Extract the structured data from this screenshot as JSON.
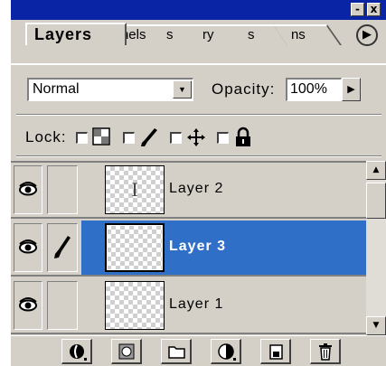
{
  "panel": {
    "title_buttons": {
      "minimize": "-",
      "close": "x"
    },
    "tabs": [
      {
        "label": "Layers",
        "active": true
      },
      {
        "label": "nels"
      },
      {
        "label": "s"
      },
      {
        "label": "ry"
      },
      {
        "label": "s"
      },
      {
        "label": "ns"
      }
    ],
    "menu_arrow": "▶"
  },
  "blend": {
    "mode": "Normal",
    "dropdown_arrow": "▼",
    "opacity_label": "Opacity:",
    "opacity_value": "100%",
    "opacity_arrow": "▶"
  },
  "lock": {
    "label": "Lock:",
    "options": [
      {
        "icon": "transparency-lock-icon",
        "checked": false
      },
      {
        "icon": "brush-lock-icon",
        "checked": false
      },
      {
        "icon": "move-lock-icon",
        "checked": false
      },
      {
        "icon": "padlock-icon",
        "checked": false
      }
    ]
  },
  "layers": [
    {
      "name": "Layer 2",
      "visible": true,
      "linked_brush": false,
      "thumbnail_text": "I",
      "selected": false
    },
    {
      "name": "Layer 3",
      "visible": true,
      "linked_brush": true,
      "thumbnail_text": "",
      "selected": true
    },
    {
      "name": "Layer 1",
      "visible": true,
      "linked_brush": false,
      "thumbnail_text": "",
      "selected": false
    }
  ],
  "scrollbar": {
    "up_arrow": "▲",
    "down_arrow": "▼"
  },
  "toolbar": {
    "buttons": [
      {
        "icon": "layer-style-icon"
      },
      {
        "icon": "layer-mask-icon"
      },
      {
        "icon": "new-set-icon"
      },
      {
        "icon": "adjustment-layer-icon"
      },
      {
        "icon": "new-layer-icon"
      },
      {
        "icon": "trash-icon"
      }
    ]
  },
  "colors": {
    "title_bar": "#0a24a6",
    "selection": "#2f6fc8",
    "panel": "#d4d0c8"
  }
}
